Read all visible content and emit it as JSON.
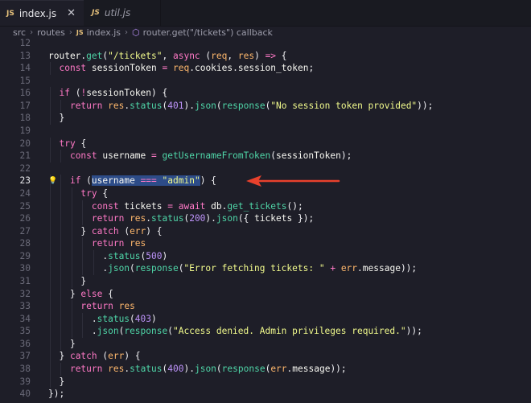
{
  "tabs": [
    {
      "badge": "JS",
      "label": "index.js",
      "close": "✕",
      "active": true
    },
    {
      "badge": "JS",
      "label": "util.js",
      "active": false
    }
  ],
  "breadcrumb": {
    "parts": [
      "src",
      "routes"
    ],
    "file_badge": "JS",
    "file": "index.js",
    "symbol": "router.get(\"/tickets\") callback"
  },
  "lines": [
    {
      "n": "12",
      "html": ""
    },
    {
      "n": "13",
      "html": "<span class=\"obj\">router</span>.<span class=\"fn\">get</span>(<span class=\"str\">\"/tickets\"</span>, <span class=\"kw\">async</span> (<span class=\"par\">req</span>, <span class=\"par\">res</span>) <span class=\"kw\">=&gt;</span> {"
    },
    {
      "n": "14",
      "html": "  <span class=\"kw\">const</span> <span class=\"var\">sessionToken</span> <span class=\"op\">=</span> <span class=\"par\">req</span>.<span class=\"obj\">cookies</span>.<span class=\"obj\">session_token</span>;"
    },
    {
      "n": "15",
      "html": ""
    },
    {
      "n": "16",
      "html": "  <span class=\"kw\">if</span> (<span class=\"op\">!</span><span class=\"var\">sessionToken</span>) {"
    },
    {
      "n": "17",
      "html": "    <span class=\"kw\">return</span> <span class=\"par\">res</span>.<span class=\"fn\">status</span>(<span class=\"num\">401</span>).<span class=\"fn\">json</span>(<span class=\"fn\">response</span>(<span class=\"str\">\"No session token provided\"</span>));"
    },
    {
      "n": "18",
      "html": "  }"
    },
    {
      "n": "19",
      "html": ""
    },
    {
      "n": "20",
      "html": "  <span class=\"kw\">try</span> {"
    },
    {
      "n": "21",
      "html": "    <span class=\"kw\">const</span> <span class=\"var\">username</span> <span class=\"op\">=</span> <span class=\"fn\">getUsernameFromToken</span>(<span class=\"var\">sessionToken</span>);"
    },
    {
      "n": "22",
      "html": ""
    },
    {
      "n": "23",
      "html": "    <span class=\"kw\">if</span> (<span class=\"sel\"><span class=\"var\">username</span> <span class=\"op\">===</span> <span class=\"str\">\"admin\"</span></span>) {",
      "current": true,
      "bulb": true
    },
    {
      "n": "24",
      "html": "      <span class=\"kw\">try</span> {"
    },
    {
      "n": "25",
      "html": "        <span class=\"kw\">const</span> <span class=\"var\">tickets</span> <span class=\"op\">=</span> <span class=\"kw\">await</span> <span class=\"obj\">db</span>.<span class=\"fn\">get_tickets</span>();"
    },
    {
      "n": "26",
      "html": "        <span class=\"kw\">return</span> <span class=\"par\">res</span>.<span class=\"fn\">status</span>(<span class=\"num\">200</span>).<span class=\"fn\">json</span>({ <span class=\"var\">tickets</span> });"
    },
    {
      "n": "27",
      "html": "      } <span class=\"kw\">catch</span> (<span class=\"par\">err</span>) {"
    },
    {
      "n": "28",
      "html": "        <span class=\"kw\">return</span> <span class=\"par\">res</span>"
    },
    {
      "n": "29",
      "html": "          .<span class=\"fn\">status</span>(<span class=\"num\">500</span>)"
    },
    {
      "n": "30",
      "html": "          .<span class=\"fn\">json</span>(<span class=\"fn\">response</span>(<span class=\"str\">\"Error fetching tickets: \"</span> <span class=\"op\">+</span> <span class=\"par\">err</span>.<span class=\"obj\">message</span>));"
    },
    {
      "n": "31",
      "html": "      }"
    },
    {
      "n": "32",
      "html": "    } <span class=\"kw\">else</span> {"
    },
    {
      "n": "33",
      "html": "      <span class=\"kw\">return</span> <span class=\"par\">res</span>"
    },
    {
      "n": "34",
      "html": "        .<span class=\"fn\">status</span>(<span class=\"num\">403</span>)"
    },
    {
      "n": "35",
      "html": "        .<span class=\"fn\">json</span>(<span class=\"fn\">response</span>(<span class=\"str\">\"Access denied. Admin privileges required.\"</span>));"
    },
    {
      "n": "36",
      "html": "    }"
    },
    {
      "n": "37",
      "html": "  } <span class=\"kw\">catch</span> (<span class=\"par\">err</span>) {"
    },
    {
      "n": "38",
      "html": "    <span class=\"kw\">return</span> <span class=\"par\">res</span>.<span class=\"fn\">status</span>(<span class=\"num\">400</span>).<span class=\"fn\">json</span>(<span class=\"fn\">response</span>(<span class=\"par\">err</span>.<span class=\"obj\">message</span>));"
    },
    {
      "n": "39",
      "html": "  }"
    },
    {
      "n": "40",
      "html": "});"
    }
  ],
  "colors": {
    "background": "#1e1e28",
    "arrow": "#e8412c",
    "selection": "#2d4c88"
  },
  "icons": {
    "bulb": "lightbulb-icon",
    "arrow": "red-arrow-annotation-icon"
  }
}
